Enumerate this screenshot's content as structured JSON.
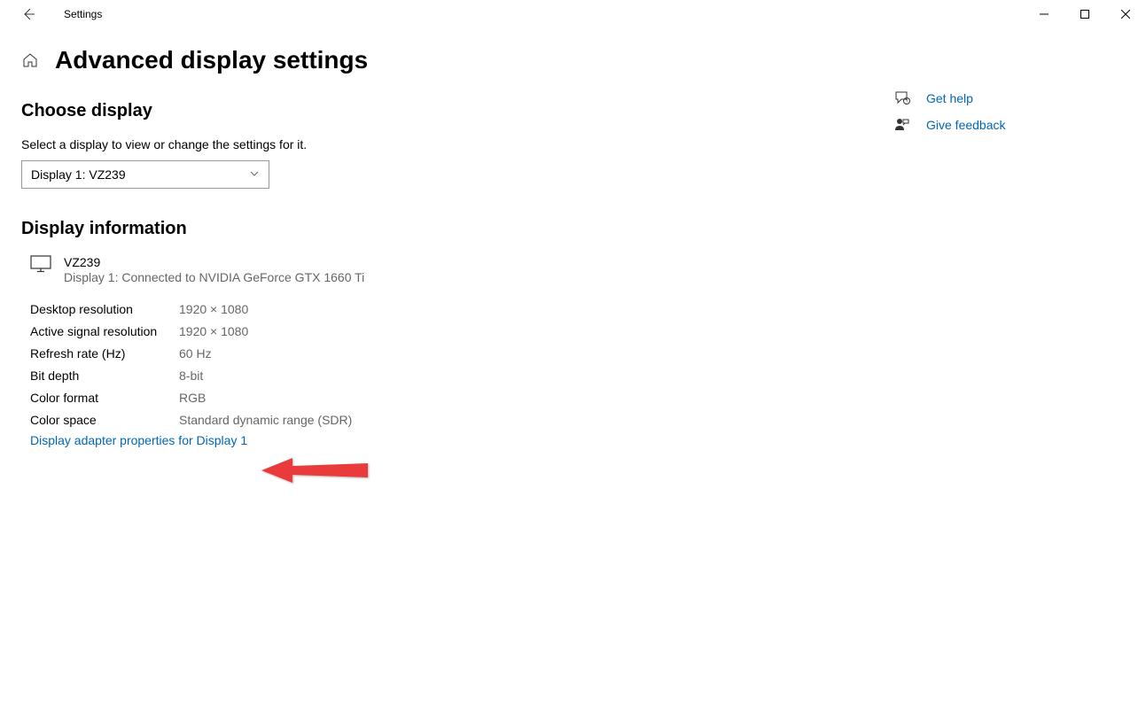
{
  "titlebar": {
    "app_name": "Settings"
  },
  "page": {
    "title": "Advanced display settings"
  },
  "choose": {
    "heading": "Choose display",
    "desc": "Select a display to view or change the settings for it.",
    "selected": "Display 1: VZ239"
  },
  "info": {
    "heading": "Display information",
    "monitor_name": "VZ239",
    "monitor_sub": "Display 1: Connected to NVIDIA GeForce GTX 1660 Ti",
    "rows": [
      {
        "label": "Desktop resolution",
        "value": "1920 × 1080"
      },
      {
        "label": "Active signal resolution",
        "value": "1920 × 1080"
      },
      {
        "label": "Refresh rate (Hz)",
        "value": "60 Hz"
      },
      {
        "label": "Bit depth",
        "value": "8-bit"
      },
      {
        "label": "Color format",
        "value": "RGB"
      },
      {
        "label": "Color space",
        "value": "Standard dynamic range (SDR)"
      }
    ],
    "adapter_link": "Display adapter properties for Display 1"
  },
  "side": {
    "help": "Get help",
    "feedback": "Give feedback"
  }
}
